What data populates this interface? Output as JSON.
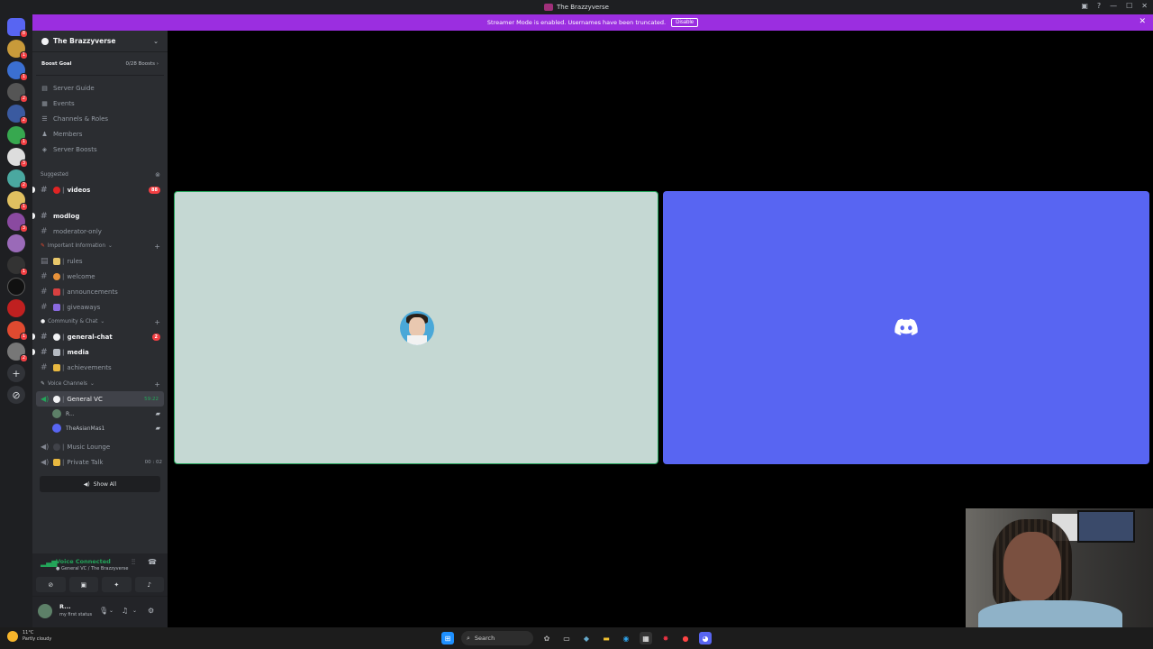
{
  "window": {
    "title": "The Brazzyverse"
  },
  "banner": {
    "message": "Streamer Mode is enabled. Usernames have been truncated.",
    "disable_label": "Disable"
  },
  "server": {
    "name": "The Brazzyverse",
    "boost_goal_label": "Boost Goal",
    "boost_count": "0/28 Boosts",
    "menu": [
      {
        "label": "Server Guide",
        "icon": "guide-icon"
      },
      {
        "label": "Events",
        "icon": "calendar-icon"
      },
      {
        "label": "Channels & Roles",
        "icon": "channels-roles-icon"
      },
      {
        "label": "Members",
        "icon": "members-icon"
      },
      {
        "label": "Server Boosts",
        "icon": "boost-icon"
      }
    ],
    "suggested_label": "Suggested",
    "suggested_channel": {
      "name": "videos",
      "badge": "88"
    },
    "channels_top": [
      "modlog",
      "moderator-only"
    ],
    "cat_important": "Important Information",
    "important_channels": [
      "rules",
      "welcome",
      "announcements",
      "giveaways"
    ],
    "cat_community": "Community & Chat",
    "community_channels": [
      {
        "name": "general-chat",
        "badge": "2"
      },
      {
        "name": "media"
      },
      {
        "name": "achievements"
      }
    ],
    "cat_voice": "Voice Channels",
    "voice": {
      "general_vc": "General VC",
      "general_timer": "59:22",
      "users": [
        "R...",
        "TheAsianMas1"
      ],
      "music_lounge": "Music Lounge",
      "private_talk": "Private Talk",
      "private_timer": "00 : 02"
    },
    "show_all": "Show All"
  },
  "voice_panel": {
    "title": "Voice Connected",
    "subtitle": "General VC / The Brazzyverse"
  },
  "user_panel": {
    "name": "R...",
    "status": "my first status"
  },
  "taskbar": {
    "weather_temp": "11°C",
    "weather_desc": "Partly cloudy",
    "search_label": "Search"
  },
  "colors": {
    "brand": "#5865f2",
    "banner": "#9b2ee0",
    "voice_green": "#23a55a",
    "tile_bg": "#c5d8d3"
  }
}
